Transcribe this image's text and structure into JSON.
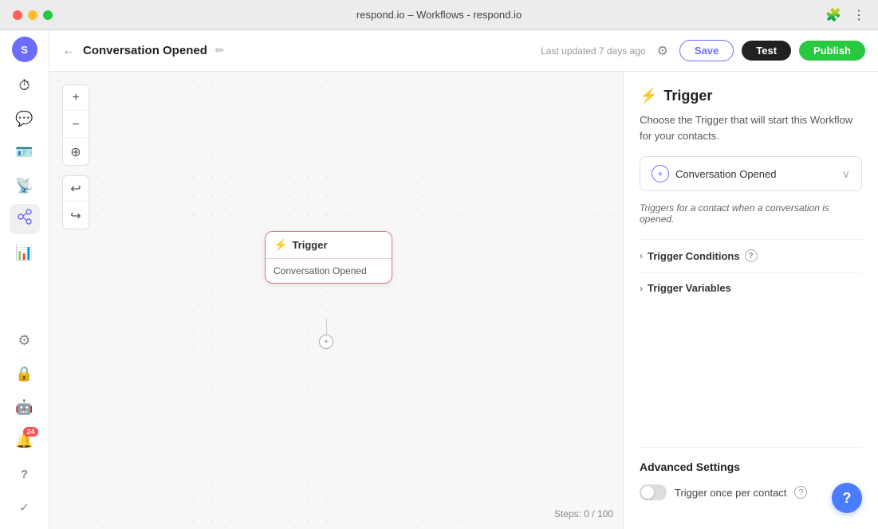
{
  "titlebar": {
    "title": "respond.io – Workflows - respond.io"
  },
  "sidebar": {
    "avatar_label": "S",
    "items": [
      {
        "id": "dashboard",
        "icon": "⏱",
        "label": "Dashboard"
      },
      {
        "id": "conversations",
        "icon": "💬",
        "label": "Conversations"
      },
      {
        "id": "contacts",
        "icon": "🪪",
        "label": "Contacts"
      },
      {
        "id": "broadcasts",
        "icon": "📡",
        "label": "Broadcasts"
      },
      {
        "id": "workflows",
        "icon": "⬡",
        "label": "Workflows",
        "active": true
      },
      {
        "id": "reports",
        "icon": "📊",
        "label": "Reports"
      },
      {
        "id": "settings",
        "icon": "⚙",
        "label": "Settings"
      },
      {
        "id": "security",
        "icon": "🔒",
        "label": "Security"
      },
      {
        "id": "automations",
        "icon": "🤖",
        "label": "Automations"
      },
      {
        "id": "notifications",
        "icon": "🔔",
        "label": "Notifications",
        "badge": "24"
      },
      {
        "id": "help",
        "icon": "?",
        "label": "Help"
      },
      {
        "id": "checkmark",
        "icon": "✓",
        "label": "Checkmark"
      }
    ]
  },
  "topbar": {
    "back_label": "←",
    "workflow_name": "Conversation Opened",
    "edit_icon": "✏",
    "last_updated": "Last updated 7 days ago",
    "settings_icon": "⚙",
    "save_label": "Save",
    "test_label": "Test",
    "publish_label": "Publish"
  },
  "canvas": {
    "controls": {
      "zoom_in": "+",
      "zoom_out": "−",
      "fit": "⊕"
    },
    "history": {
      "undo": "↩",
      "redo": "↪"
    },
    "trigger_node": {
      "header": "Trigger",
      "body": "Conversation Opened"
    },
    "steps_label": "Steps: 0 / 100"
  },
  "right_panel": {
    "title": "Trigger",
    "description": "Choose the Trigger that will start this Workflow for your contacts.",
    "selected_trigger": "Conversation Opened",
    "trigger_hint": "Triggers for a contact when a conversation is opened.",
    "conditions_label": "Trigger Conditions",
    "variables_label": "Trigger Variables",
    "advanced_settings": {
      "title": "Advanced Settings",
      "toggle_label": "Trigger once per contact",
      "help_icon": "?"
    }
  },
  "help_button": {
    "label": "?"
  },
  "colors": {
    "accent_purple": "#6c6cff",
    "accent_green": "#28c840",
    "accent_red": "#e57373",
    "accent_orange": "#f5a623",
    "accent_blue": "#4a7cff",
    "badge_red": "#ff4d4f"
  }
}
